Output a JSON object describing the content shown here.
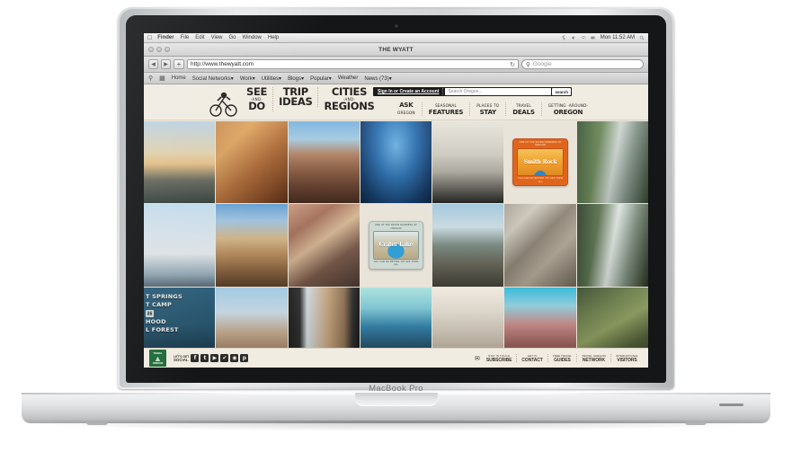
{
  "device": {
    "model_label": "MacBook Pro"
  },
  "os_menubar": {
    "apple_icon": "apple-icon",
    "items": [
      "Finder",
      "File",
      "Edit",
      "View",
      "Go",
      "Window",
      "Help"
    ],
    "clock": "Mon 11:52 AM",
    "status_icons": [
      "bluetooth-icon",
      "volume-icon",
      "wifi-icon",
      "battery-icon",
      "spotlight-icon"
    ]
  },
  "browser": {
    "window_title": "THE WYATT",
    "traffic_lights": [
      "close-button",
      "minimize-button",
      "zoom-button"
    ],
    "back_label": "◀",
    "forward_label": "▶",
    "add_label": "+",
    "url": "http://www.thewyatt.com",
    "reload_icon": "reload-icon",
    "google_placeholder": "Google",
    "google_icon": "google-search-icon",
    "bookmarks": [
      "Home",
      "Social Networks▾",
      "Work▾",
      "Utilities▾",
      "Blogs▾",
      "Popular▾",
      "Weather",
      "News (73)▾"
    ]
  },
  "site": {
    "logo": "bicycle-rider-logo",
    "utility": {
      "signin_label": "Sign In or Create an Account",
      "search_placeholder": "Search Oregon...",
      "search_button_label": "search"
    },
    "primary_nav": [
      {
        "line1": "SEE",
        "and": "-AND-",
        "line2": "DO"
      },
      {
        "line1": "TRIP",
        "and": "",
        "line2": "IDEAS"
      },
      {
        "line1": "CITIES",
        "and": "-AND-",
        "line2": "REGIONS"
      }
    ],
    "secondary_nav": [
      {
        "big": "ASK",
        "small": "OREGON",
        "small_first": false
      },
      {
        "big": "FEATURES",
        "small": "SEASONAL",
        "small_first": true
      },
      {
        "big": "STAY",
        "small": "PLACES TO",
        "small_first": true
      },
      {
        "big": "DEALS",
        "small": "TRAVEL",
        "small_first": true
      },
      {
        "big": "OREGON",
        "small": "GETTING -AROUND-",
        "small_first": true
      }
    ],
    "grid": {
      "row1": [
        {
          "name": "sunset-over-valley",
          "class": "t-sunset"
        },
        {
          "name": "rock-climbers-on-cliff",
          "class": "t-climb"
        },
        {
          "name": "painted-hills-landscape",
          "class": "t-hills1"
        },
        {
          "name": "crater-lake-aerial",
          "class": "t-craterair"
        },
        {
          "name": "hiker-on-cliff-silhouette",
          "class": "t-cliff"
        },
        {
          "name": "smith-rock-badge",
          "class": "t-badge1"
        },
        {
          "name": "forest-waterfall",
          "class": "t-waterfall1"
        }
      ],
      "row2": [
        {
          "name": "ski-lift-in-snow",
          "class": "t-skilift"
        },
        {
          "name": "smith-rock-spires",
          "class": "t-smithrock"
        },
        {
          "name": "painted-hills-closeup",
          "class": "t-hills2"
        },
        {
          "name": "crater-lake-badge",
          "class": "t-badge2"
        },
        {
          "name": "oregon-coast-rocks",
          "class": "t-coast"
        },
        {
          "name": "whitewater-kayakers",
          "class": "t-kayak"
        },
        {
          "name": "multnomah-falls",
          "class": "t-waterfall2"
        }
      ],
      "row3": [
        {
          "name": "forest-service-sign",
          "class": "t-sign"
        },
        {
          "name": "hiker-celebrating-summit",
          "class": "t-hiker"
        },
        {
          "name": "view-through-car-window",
          "class": "t-window"
        },
        {
          "name": "person-pointing-at-crater-lake",
          "class": "t-pointing"
        },
        {
          "name": "boat-on-shore",
          "class": "t-boat"
        },
        {
          "name": "desert-canyon-overlook",
          "class": "t-canyon"
        },
        {
          "name": "mossy-forest-trail",
          "class": "t-forest"
        }
      ]
    },
    "badges": {
      "smith_rock": {
        "top_text": "ONE OF THE SEVEN WONDERS OF OREGON",
        "title": "Smith Rock",
        "bottom_text": "YOU CAN DO BETTER YET SEE THEM ALL"
      },
      "crater_lake": {
        "top_text": "ONE OF THE SEVEN WONDERS OF OREGON",
        "title": "Crater Lake",
        "bottom_text": "YOU CAN DO BETTER YET SEE THEM ALL"
      }
    },
    "overlay_sign": {
      "line1": "T SPRINGS",
      "line2": "T CAMP",
      "shield": "26",
      "line3": "HOOD",
      "line4": "L FOREST"
    },
    "footer": {
      "brand_top": "TRAVEL",
      "brand_bottom": "OREGON",
      "tree_icon": "fir-tree-icon",
      "social_label_small": "LET'S GET",
      "social_label_big": "SOCIAL",
      "social_icons": [
        {
          "name": "facebook-icon",
          "glyph": "f"
        },
        {
          "name": "twitter-icon",
          "glyph": "t"
        },
        {
          "name": "youtube-icon",
          "glyph": "▶"
        },
        {
          "name": "foursquare-icon",
          "glyph": "✔"
        },
        {
          "name": "instagram-icon",
          "glyph": "◉"
        },
        {
          "name": "pinterest-icon",
          "glyph": "p"
        }
      ],
      "links": [
        {
          "small": "STAY IN TOUCH",
          "big": "SUBSCRIBE",
          "icon": "envelope-icon"
        },
        {
          "small": "GET IN",
          "big": "CONTACT",
          "icon": ""
        },
        {
          "small": "FREE TRAVEL",
          "big": "GUIDES",
          "icon": ""
        },
        {
          "small": "TRAVEL OREGON",
          "big": "NETWORK",
          "icon": ""
        },
        {
          "small": "INTERNATIONAL",
          "big": "VISITORS",
          "icon": ""
        }
      ]
    }
  }
}
